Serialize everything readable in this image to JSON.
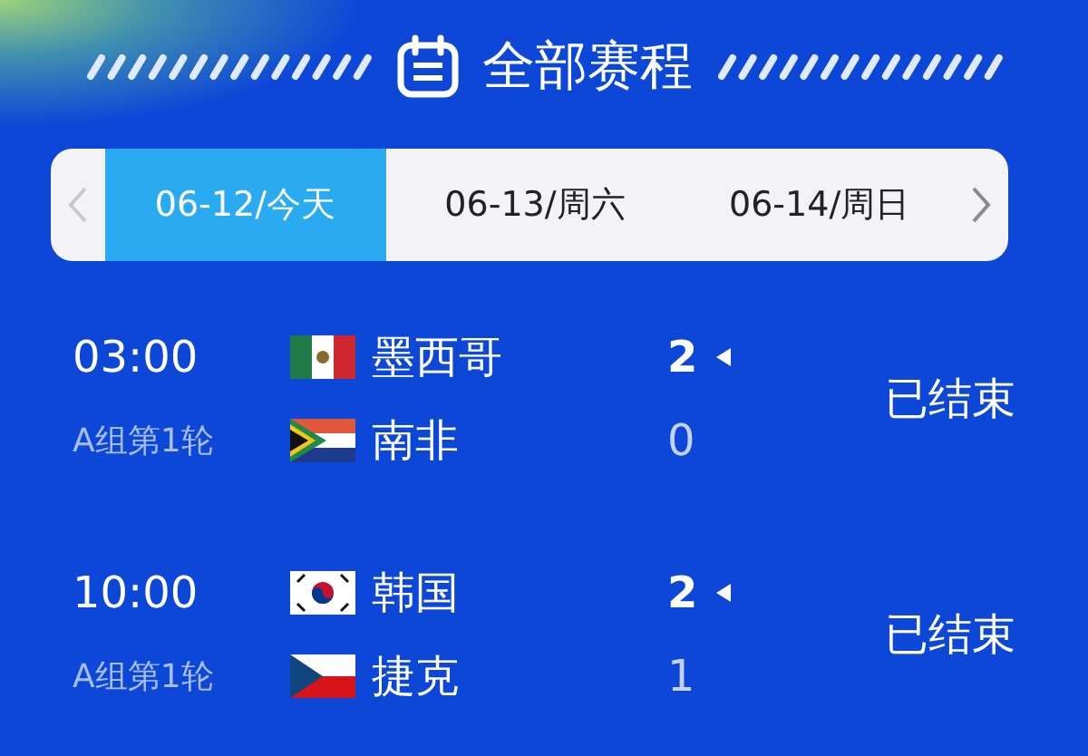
{
  "header": {
    "title": "全部赛程"
  },
  "date_tabs": [
    {
      "label": "06-12/今天",
      "selected": true
    },
    {
      "label": "06-13/周六",
      "selected": false
    },
    {
      "label": "06-14/周日",
      "selected": false
    }
  ],
  "matches": [
    {
      "time": "03:00",
      "round": "A组第1轮",
      "status": "已结束",
      "teams": [
        {
          "name": "墨西哥",
          "score": "2",
          "winner": true
        },
        {
          "name": "南非",
          "score": "0",
          "winner": false
        }
      ]
    },
    {
      "time": "10:00",
      "round": "A组第1轮",
      "status": "已结束",
      "teams": [
        {
          "name": "韩国",
          "score": "2",
          "winner": true
        },
        {
          "name": "捷克",
          "score": "1",
          "winner": false
        }
      ]
    }
  ]
}
